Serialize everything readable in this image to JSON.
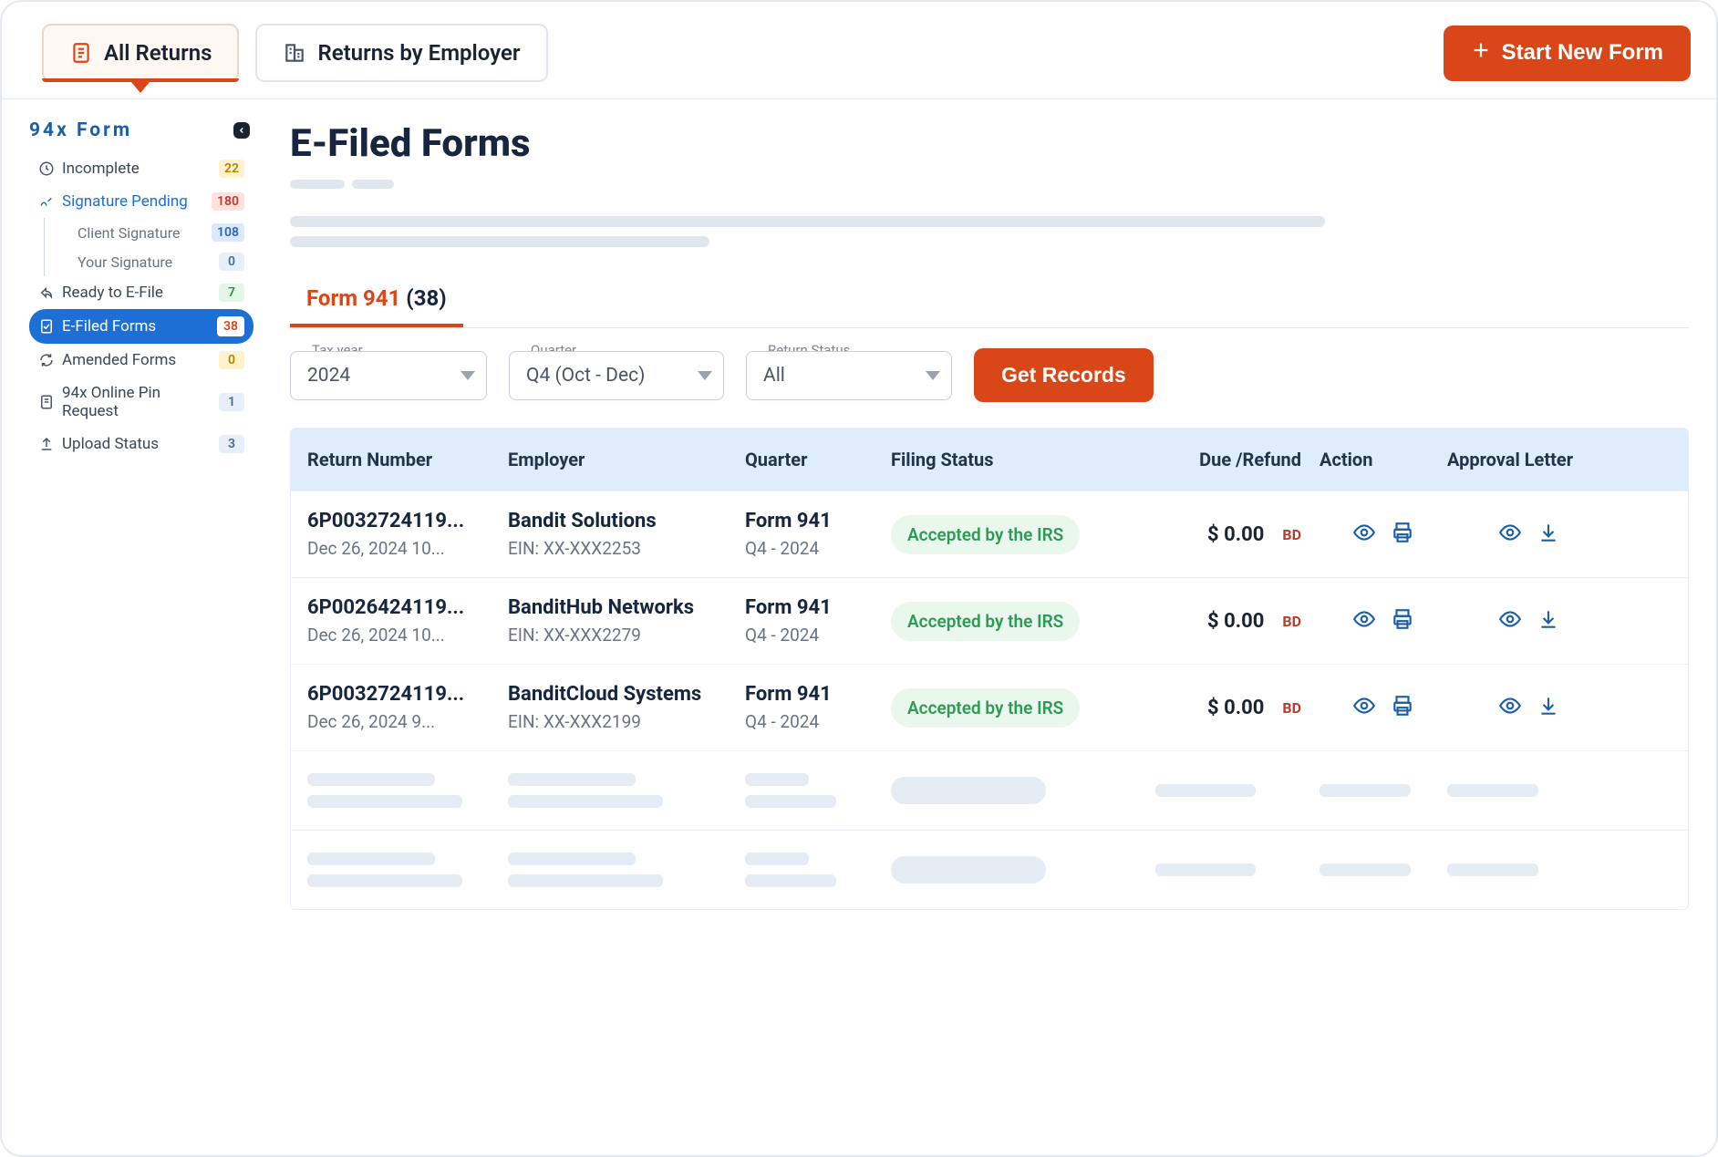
{
  "topbar": {
    "tab_all_returns": "All Returns",
    "tab_by_employer": "Returns by Employer",
    "start_new": "Start New Form"
  },
  "sidebar": {
    "title": "94x Form",
    "items": [
      {
        "label": "Incomplete",
        "badge": "22",
        "badgeClass": "badge-yellow"
      },
      {
        "label": "Signature Pending",
        "badge": "180",
        "badgeClass": "badge-red"
      },
      {
        "label": "Client Signature",
        "badge": "108",
        "badgeClass": "badge-blue"
      },
      {
        "label": "Your Signature",
        "badge": "0",
        "badgeClass": "badge-bluelt"
      },
      {
        "label": "Ready to E-File",
        "badge": "7",
        "badgeClass": "badge-green"
      },
      {
        "label": "E-Filed Forms",
        "badge": "38",
        "badgeClass": "badge-white"
      },
      {
        "label": "Amended Forms",
        "badge": "0",
        "badgeClass": "badge-yellow2"
      },
      {
        "label": "94x Online Pin Request",
        "badge": "1",
        "badgeClass": "badge-bluelt"
      },
      {
        "label": "Upload Status",
        "badge": "3",
        "badgeClass": "badge-bluelt"
      }
    ]
  },
  "main": {
    "title": "E-Filed Forms",
    "inner_tab_name": "Form 941",
    "inner_tab_count": "(38)",
    "filters": {
      "tax_year_label": "Tax year",
      "tax_year_value": "2024",
      "quarter_label": "Quarter",
      "quarter_value": "Q4 (Oct - Dec)",
      "status_label": "Return Status",
      "status_value": "All",
      "get_records": "Get Records"
    },
    "columns": {
      "return_number": "Return Number",
      "employer": "Employer",
      "quarter": "Quarter",
      "filing_status": "Filing Status",
      "due_refund": "Due /Refund",
      "action": "Action",
      "approval_letter": "Approval Letter"
    },
    "rows": [
      {
        "return_number": "6P0032724119...",
        "datetime": "Dec 26, 2024 10...",
        "employer": "Bandit Solutions",
        "ein": "EIN: XX-XXX2253",
        "form": "Form 941",
        "period": "Q4 - 2024",
        "status": "Accepted by the IRS",
        "due": "$ 0.00",
        "bd": "BD"
      },
      {
        "return_number": "6P0026424119...",
        "datetime": "Dec 26, 2024 10...",
        "employer": "BanditHub Networks",
        "ein": "EIN: XX-XXX2279",
        "form": "Form 941",
        "period": "Q4 - 2024",
        "status": "Accepted by the IRS",
        "due": "$ 0.00",
        "bd": "BD"
      },
      {
        "return_number": "6P0032724119...",
        "datetime": "Dec 26, 2024 9...",
        "employer": "BanditCloud Systems",
        "ein": "EIN: XX-XXX2199",
        "form": "Form 941",
        "period": "Q4 - 2024",
        "status": "Accepted by the IRS",
        "due": "$ 0.00",
        "bd": "BD"
      }
    ]
  }
}
